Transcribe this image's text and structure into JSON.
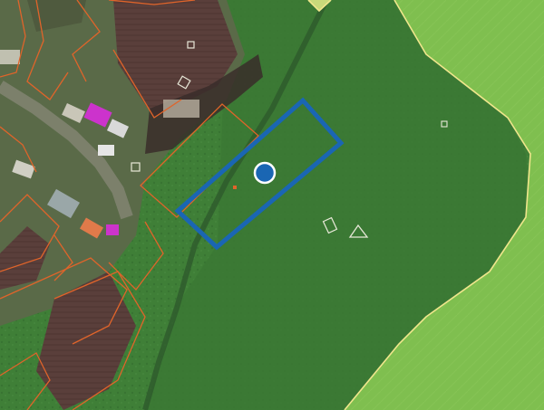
{
  "map": {
    "type": "cadastral-satellite",
    "watermark": "",
    "colors": {
      "selected_parcel_outline": "#1a66b3",
      "location_marker_fill": "#1a66b3",
      "location_marker_stroke": "#ffffff",
      "cadastral_boundary": "#e0642a",
      "field_boundary": "#f0e68c",
      "field_fill": "#7fbf4f",
      "meadow": "#3f7f37",
      "village_ground": "#5a6a48",
      "plowed_soil": "#5a3f3b",
      "roof_magenta": "#cc33cc"
    },
    "features": {
      "selected_parcel": "selected-parcel-boundary",
      "location_marker": "location-pin",
      "map_markers": [
        "square-marker",
        "square-marker",
        "square-marker",
        "triangle-marker"
      ]
    }
  }
}
